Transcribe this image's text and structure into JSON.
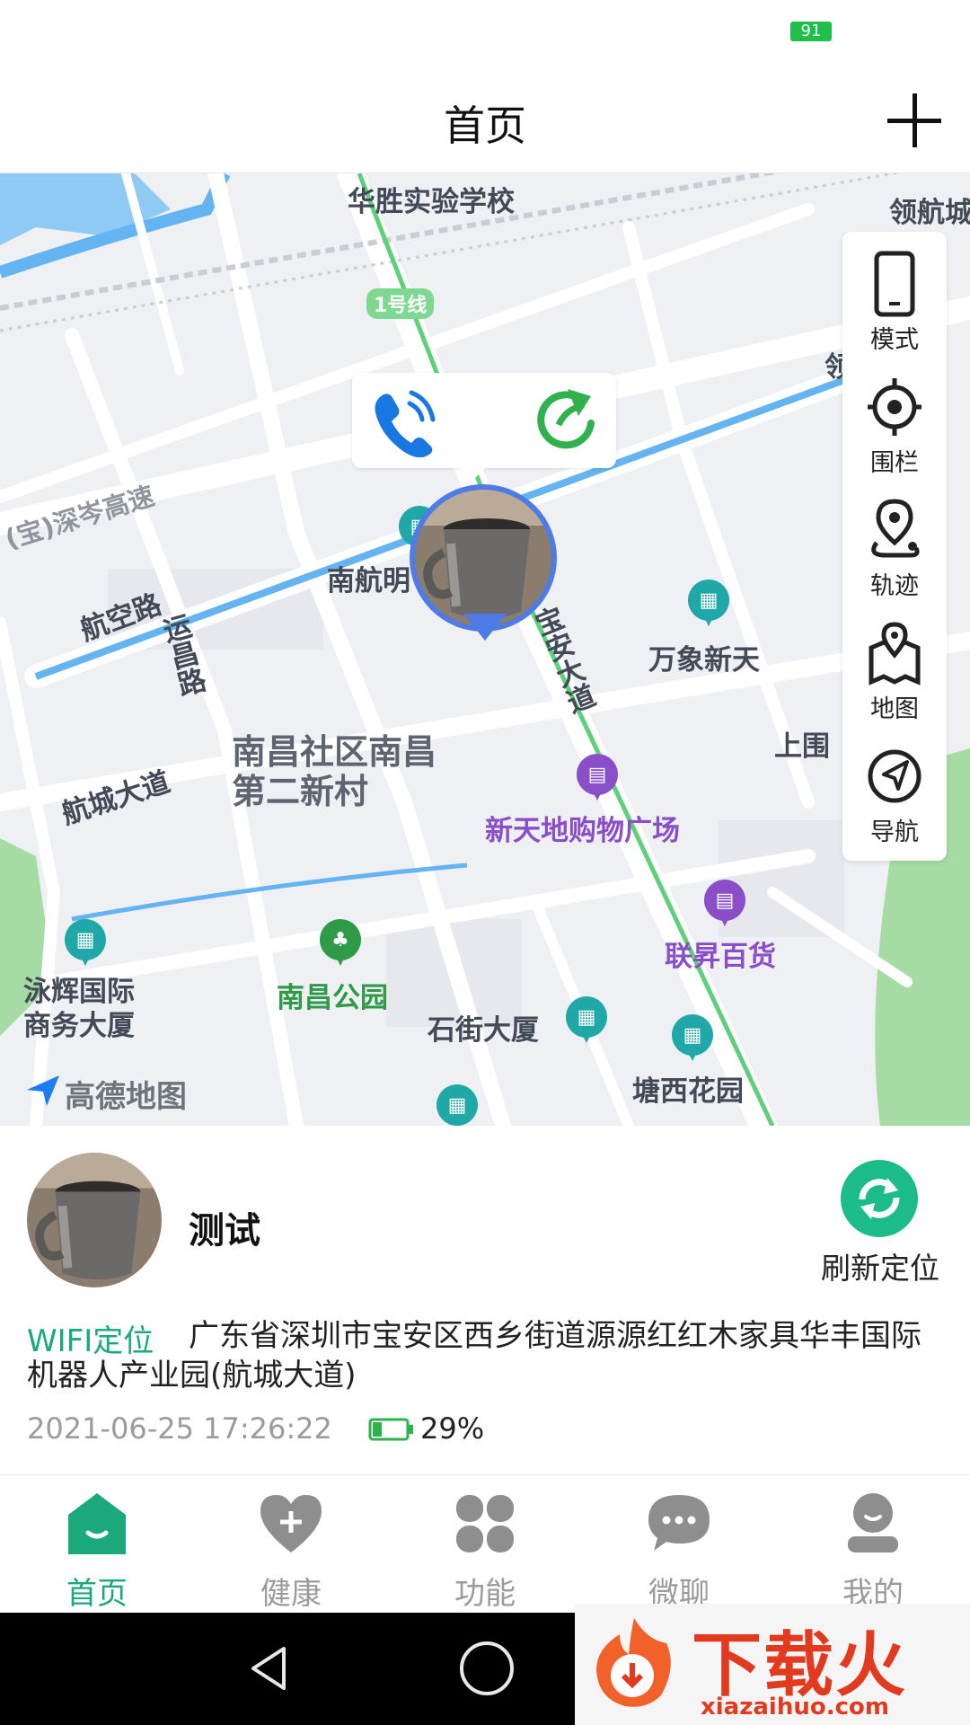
{
  "status_bar": {
    "battery": "91"
  },
  "header": {
    "title": "首页",
    "add_icon": "plus-icon"
  },
  "map": {
    "labels": {
      "school": "华胜实验学校",
      "metro": "1号线",
      "lingang_top": "领航城",
      "lingang_side": "领航城扬",
      "expressway": "(宝)深岑高速",
      "hangkong_road": "航空路",
      "yunchang_road": "运昌路",
      "nanhang": "南航明",
      "baoan_blvd": "宝安大道",
      "wanxiang": "万象新天",
      "shangwei": "上围",
      "hangcheng_blvd": "航城大道",
      "nanchang_community": "南昌社区南昌第二新村",
      "xintiandi": "新天地购物广场",
      "lianyu": "联昇百货",
      "yonghui": "泳辉国际商务大厦",
      "nanchang_park": "南昌公园",
      "shijie": "石街大厦",
      "tangxi": "塘西花园",
      "brand": "高德地图"
    },
    "popup": {
      "phone_icon": "phone-call-icon",
      "refresh_icon": "refresh-arrow-icon"
    },
    "toolbar": [
      {
        "label": "模式",
        "icon": "phone-device-icon"
      },
      {
        "label": "围栏",
        "icon": "crosshair-icon"
      },
      {
        "label": "轨迹",
        "icon": "track-pin-icon"
      },
      {
        "label": "地图",
        "icon": "map-icon"
      },
      {
        "label": "导航",
        "icon": "navigation-icon"
      }
    ]
  },
  "device": {
    "name": "测试",
    "refresh_label": "刷新定位",
    "location_type": "WIFI定位",
    "address": "广东省深圳市宝安区西乡街道源源红红木家具华丰国际机器人产业园(航城大道)",
    "timestamp": "2021-06-25 17:26:22",
    "battery": "29%",
    "battery_level": 0.29
  },
  "tabs": [
    {
      "label": "首页",
      "icon": "home-icon",
      "active": true
    },
    {
      "label": "健康",
      "icon": "heart-plus-icon",
      "active": false
    },
    {
      "label": "功能",
      "icon": "clover-icon",
      "active": false
    },
    {
      "label": "微聊",
      "icon": "chat-bubble-icon",
      "active": false
    },
    {
      "label": "我的",
      "icon": "user-icon",
      "active": false
    }
  ],
  "watermark": {
    "main": "下载火",
    "sub": "xiazaihuo.com"
  },
  "colors": {
    "accent": "#1ba97c",
    "marker": "#4e7be6",
    "map_bg": "#eef0f3",
    "water": "#63b4f0",
    "metro": "#5fd07a"
  }
}
